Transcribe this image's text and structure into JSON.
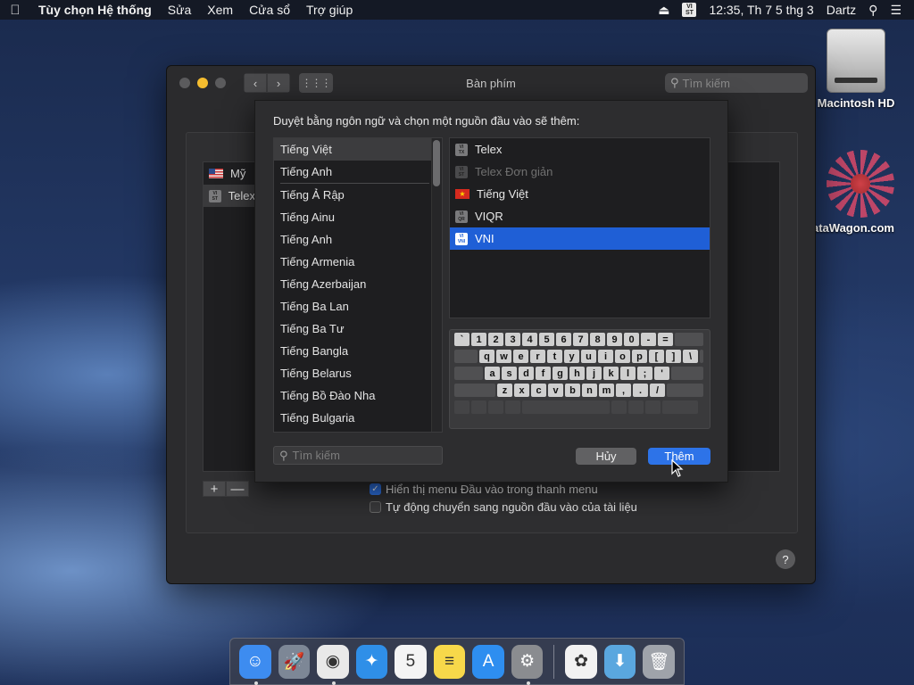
{
  "menubar": {
    "apple_icon": "apple-icon",
    "app_name": "Tùy chọn Hệ thống",
    "menus": [
      "Sửa",
      "Xem",
      "Cửa sổ",
      "Trợ giúp"
    ],
    "eject_icon": "eject-icon",
    "input_badge": "VI ST",
    "clock": "12:35, Th 7 5 thg 3",
    "user": "Dartz",
    "search_icon": "spotlight-search-icon",
    "notif_icon": "notification-center-icon"
  },
  "desktop": {
    "icons": [
      {
        "label": "Macintosh HD"
      },
      {
        "label": "ataWagon.com"
      }
    ]
  },
  "window": {
    "title": "Bàn phím",
    "search_placeholder": "Tìm kiếm",
    "sources": [
      {
        "label": "Mỹ",
        "icon": "us-flag-icon"
      },
      {
        "label": "Telex",
        "icon": "vi-telex-badge-icon"
      }
    ],
    "add_symbol": "+",
    "remove_symbol": "—",
    "options": [
      {
        "label": "Hiển thị menu Đầu vào trong thanh menu",
        "checked": true
      },
      {
        "label": "Tự động chuyển sang nguồn đầu vào của tài liệu",
        "checked": false
      }
    ],
    "help_symbol": "?"
  },
  "sheet": {
    "heading": "Duyệt bằng ngôn ngữ và chọn một nguồn đầu vào sẽ thêm:",
    "languages_top": [
      "Tiếng Việt",
      "Tiếng Anh"
    ],
    "languages": [
      "Tiếng Ả Rập",
      "Tiếng Ainu",
      "Tiếng Anh",
      "Tiếng Armenia",
      "Tiếng Azerbaijan",
      "Tiếng Ba Lan",
      "Tiếng Ba Tư",
      "Tiếng Bangla",
      "Tiếng Belarus",
      "Tiếng Bồ Đào Nha",
      "Tiếng Bulgaria"
    ],
    "input_sources": [
      {
        "label": "Telex",
        "badge": "VI TX",
        "state": "normal"
      },
      {
        "label": "Telex Đơn giản",
        "badge": "VI ST",
        "state": "disabled"
      },
      {
        "label": "Tiếng Việt",
        "badge": "vn-flag-icon",
        "state": "normal"
      },
      {
        "label": "VIQR",
        "badge": "VI QR",
        "state": "normal"
      },
      {
        "label": "VNI",
        "badge": "VI VNI",
        "state": "selected"
      }
    ],
    "keyboard_rows": [
      [
        "`",
        "1",
        "2",
        "3",
        "4",
        "5",
        "6",
        "7",
        "8",
        "9",
        "0",
        "-",
        "="
      ],
      [
        "q",
        "w",
        "e",
        "r",
        "t",
        "y",
        "u",
        "i",
        "o",
        "p",
        "[",
        "]",
        "\\"
      ],
      [
        "a",
        "s",
        "d",
        "f",
        "g",
        "h",
        "j",
        "k",
        "l",
        ";",
        "'"
      ],
      [
        "z",
        "x",
        "c",
        "v",
        "b",
        "n",
        "m",
        ",",
        ".",
        "/"
      ]
    ],
    "search_placeholder": "Tìm kiếm",
    "cancel_label": "Hủy",
    "add_label": "Thêm"
  },
  "dock": {
    "apps": [
      {
        "name": "finder-icon",
        "color": "#3d8cf0",
        "glyph": "☺",
        "running": true
      },
      {
        "name": "launchpad-icon",
        "color": "#7d8796",
        "glyph": "🚀",
        "running": false
      },
      {
        "name": "chrome-icon",
        "color": "#e9e9e9",
        "glyph": "◉",
        "running": true
      },
      {
        "name": "safari-icon",
        "color": "#2f8fe8",
        "glyph": "✦",
        "running": false
      },
      {
        "name": "calendar-icon",
        "color": "#f4f4f4",
        "glyph": "5",
        "running": false
      },
      {
        "name": "notes-icon",
        "color": "#f7d84a",
        "glyph": "≡",
        "running": false
      },
      {
        "name": "app-store-icon",
        "color": "#2e8ef0",
        "glyph": "A",
        "running": false
      },
      {
        "name": "system-preferences-icon",
        "color": "#8a8c90",
        "glyph": "⚙",
        "running": true
      }
    ],
    "extras": [
      {
        "name": "photos-icon",
        "color": "#f2f2f2",
        "glyph": "✿"
      },
      {
        "name": "downloads-folder-icon",
        "color": "#5aa7df",
        "glyph": "⬇"
      },
      {
        "name": "trash-icon",
        "color": "#9fa3aa",
        "glyph": "🗑"
      }
    ]
  }
}
